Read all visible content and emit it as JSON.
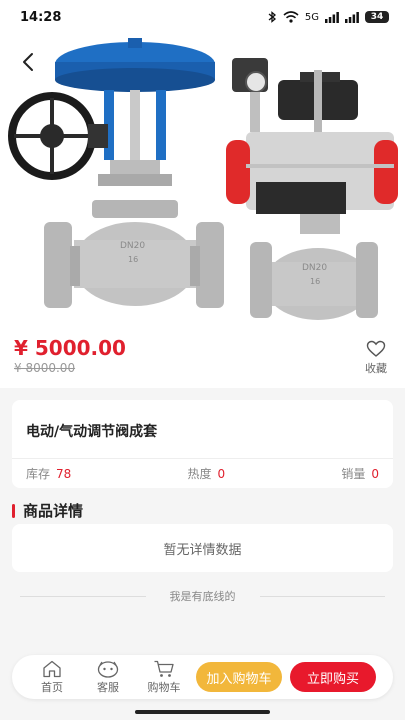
{
  "status_bar": {
    "time": "14:28",
    "network": "5G",
    "battery": "34"
  },
  "product": {
    "price": "¥ 5000.00",
    "original_price": "¥ 8000.00",
    "favorite_label": "收藏",
    "title": "电动/气动调节阀成套",
    "stats": {
      "stock_label": "库存",
      "stock_value": "78",
      "heat_label": "热度",
      "heat_value": "0",
      "sales_label": "销量",
      "sales_value": "0"
    }
  },
  "detail": {
    "section_title": "商品详情",
    "empty_text": "暂无详情数据",
    "bottom_text": "我是有底线的"
  },
  "tabbar": {
    "home": "首页",
    "service": "客服",
    "cart": "购物车",
    "add_to_cart": "加入购物车",
    "buy_now": "立即购买"
  },
  "colors": {
    "accent_red": "#e0202e",
    "cart_yellow": "#f2b73b",
    "buy_red": "#e8192c"
  }
}
